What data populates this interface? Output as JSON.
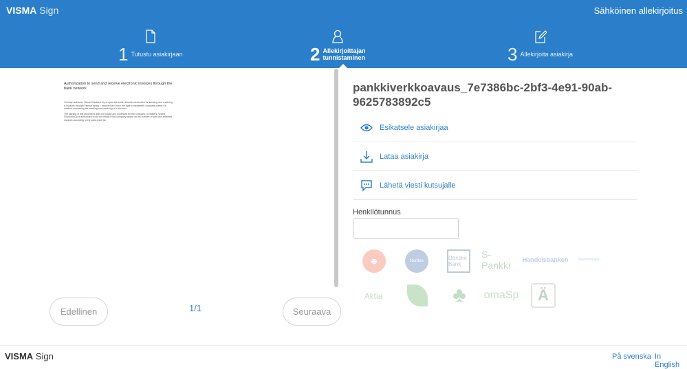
{
  "header": {
    "logo_brand": "VISMA",
    "logo_product": "Sign",
    "title": "Sähköinen allekirjoitus",
    "brand_color": "#2b7fca"
  },
  "steps": [
    {
      "number": "1",
      "label": "Tutustu asiakirjaan",
      "icon": "document-icon",
      "active": false
    },
    {
      "number": "2",
      "label_line1": "Allekirjoittajan",
      "label_line2": "tunnistaminen",
      "icon": "user-icon",
      "active": true
    },
    {
      "number": "3",
      "label": "Allekirjoita asiakirja",
      "icon": "edit-icon",
      "active": false
    }
  ],
  "document": {
    "heading": "Authorization to send and receive electronic invoices through the bank network",
    "para1": "I hereby authorize Visma Solutions Oy to open the bank network connection for sending and receiving e-invoices through Finnish banks. I assure that I have the right to represent <company name> in matters concerning the sending and receiving of e-invoices.",
    "para2": "The signing of this document does not cause any expenses for the company. In matters, Visma Solutions Oy is authorized to act on behalf of the company based on the number of sent and received invoices according to the valid price list."
  },
  "pager": {
    "previous": "Edellinen",
    "next": "Seuraava",
    "page": "1/1"
  },
  "right": {
    "doc_title": "pankkiverkkoavaus_7e7386bc-2bf3-4e91-90ab-9625783892c5",
    "actions": [
      {
        "label": "Esikatsele asiakirjaa",
        "icon": "eye-icon"
      },
      {
        "label": "Lataa asiakirja",
        "icon": "download-icon"
      },
      {
        "label": "Lähetä viesti kutsujalle",
        "icon": "chat-icon"
      }
    ],
    "field_label": "Henkilötunnus",
    "field_value": ""
  },
  "banks": [
    "OP",
    "Nordea",
    "Danske Bank",
    "S-Pankki",
    "Handelsbanken",
    "Ålandsbanken",
    "Aktia",
    "POP Pankki",
    "Säästöpankki",
    "omaSp",
    "Ålandsbanken Ä"
  ],
  "footer": {
    "logo_brand": "VISMA",
    "logo_product": "Sign",
    "link_sv": "På svenska",
    "link_en": "In English"
  }
}
